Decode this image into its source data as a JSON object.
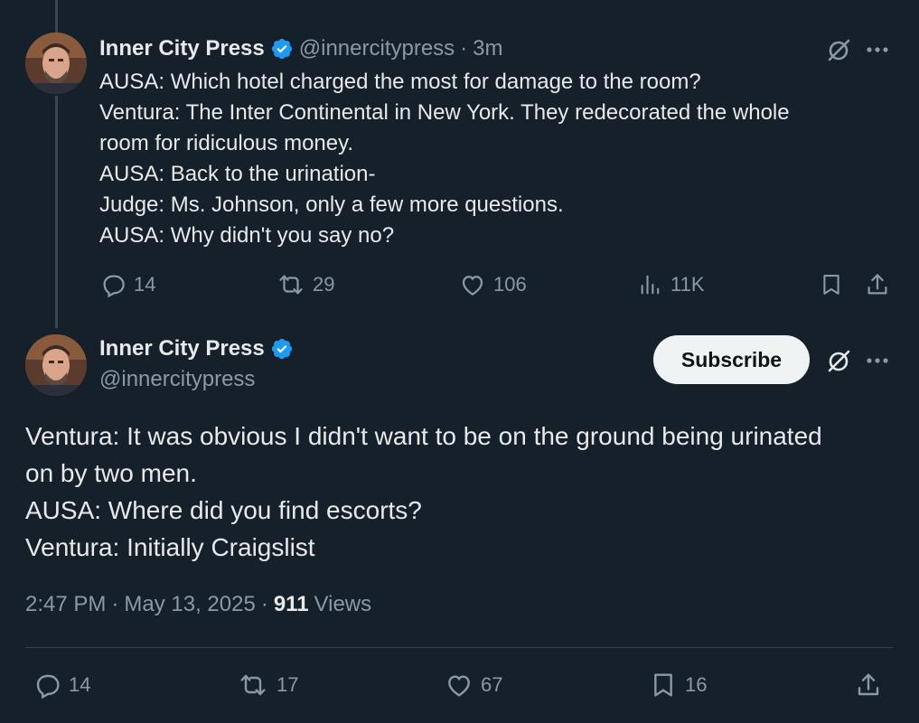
{
  "tweet1": {
    "author": "Inner City Press",
    "handle": "@innercitypress",
    "separator": "·",
    "time_ago": "3m",
    "lines": [
      "AUSA: Which hotel charged the most for damage to the room?",
      "Ventura: The Inter Continental in New York. They redecorated the whole",
      "room for ridiculous money.",
      "AUSA: Back to the urination-",
      "Judge: Ms. Johnson, only a few more questions.",
      "AUSA: Why didn't you say no?"
    ],
    "stats": {
      "replies": "14",
      "reposts": "29",
      "likes": "106",
      "views": "11K"
    }
  },
  "tweet2": {
    "author": "Inner City Press",
    "handle": "@innercitypress",
    "subscribe_label": "Subscribe",
    "lines": [
      "Ventura: It was obvious I didn't want to be on the ground being urinated",
      "on by two men.",
      "AUSA: Where did you find escorts?",
      "Ventura: Initially Craigslist"
    ],
    "time": "2:47 PM",
    "separator": "·",
    "date": "May 13, 2025",
    "views_count": "911",
    "views_label": "Views",
    "stats": {
      "replies": "14",
      "reposts": "17",
      "likes": "67",
      "bookmarks": "16"
    }
  },
  "icons": {
    "verified": "verified-badge-icon",
    "grok": "grok-icon",
    "more": "more-icon",
    "reply": "reply-icon",
    "repost": "repost-icon",
    "like": "heart-icon",
    "views": "views-icon",
    "bookmark": "bookmark-icon",
    "share": "share-icon"
  },
  "colors": {
    "background": "#15202b",
    "text": "#e7e9ea",
    "muted": "#8b98a5",
    "verified": "#1d9bf0",
    "subscribe_bg": "#eff3f4"
  }
}
